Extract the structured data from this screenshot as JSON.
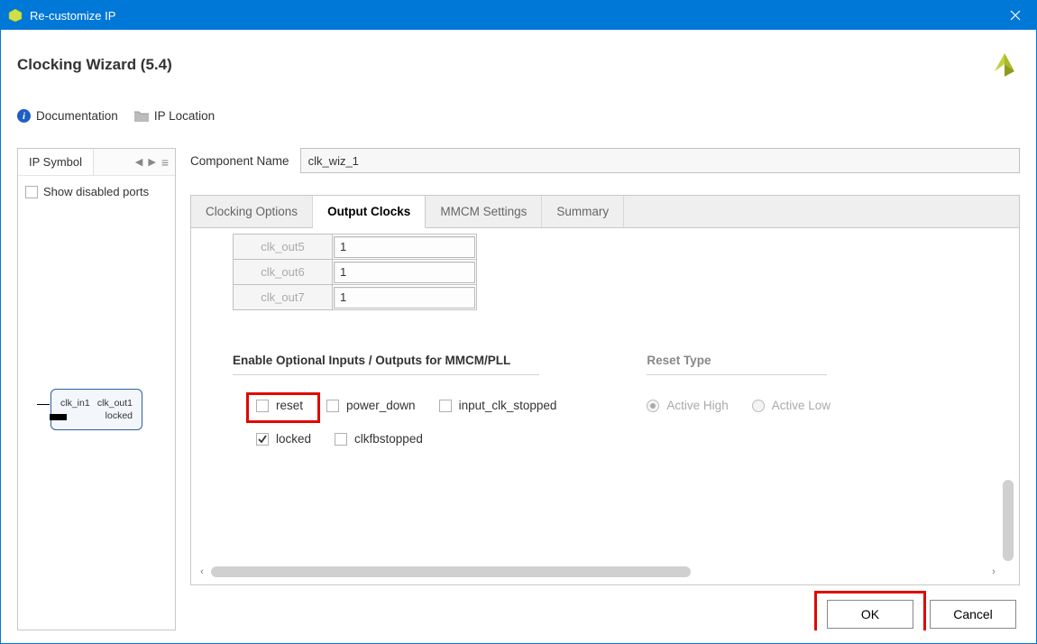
{
  "window": {
    "title": "Re-customize IP"
  },
  "heading": "Clocking Wizard (5.4)",
  "linkbar": {
    "documentation": "Documentation",
    "ip_location": "IP Location"
  },
  "left_panel": {
    "tab": "IP Symbol",
    "show_disabled": "Show disabled ports"
  },
  "symbol": {
    "in": "clk_in1",
    "out1": "clk_out1",
    "out2": "locked"
  },
  "component_name": {
    "label": "Component Name",
    "value": "clk_wiz_1"
  },
  "tabs": {
    "t1": "Clocking Options",
    "t2": "Output Clocks",
    "t3": "MMCM Settings",
    "t4": "Summary"
  },
  "clk_rows": {
    "r5": {
      "name": "clk_out5",
      "val": "1"
    },
    "r6": {
      "name": "clk_out6",
      "val": "1"
    },
    "r7": {
      "name": "clk_out7",
      "val": "1"
    }
  },
  "sections": {
    "enable": "Enable Optional Inputs / Outputs for MMCM/PLL",
    "reset_type": "Reset Type"
  },
  "checks": {
    "reset": "reset",
    "power_down": "power_down",
    "input_clk_stopped": "input_clk_stopped",
    "locked": "locked",
    "clkfbstopped": "clkfbstopped"
  },
  "radios": {
    "active_high": "Active High",
    "active_low": "Active Low"
  },
  "buttons": {
    "ok": "OK",
    "cancel": "Cancel"
  }
}
